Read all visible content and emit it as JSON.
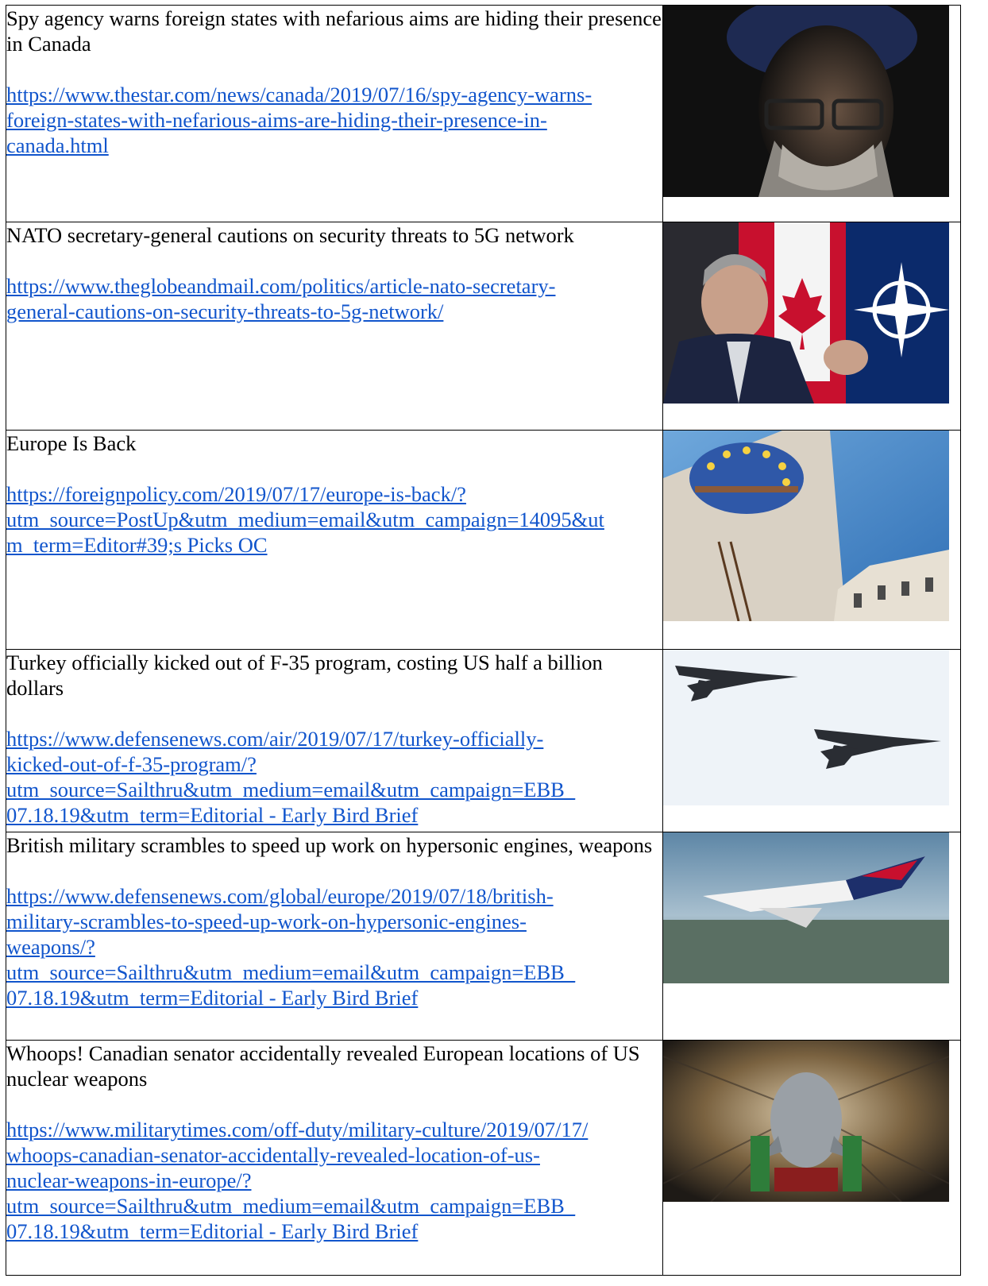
{
  "articles": [
    {
      "headline": "Spy agency warns foreign states with nefarious aims are hiding their presence in Canada",
      "link_lines": [
        "https://www.thestar.com/news/canada/2019/07/16/spy-agency-warns-",
        "foreign-states-with-nefarious-aims-are-hiding-their-presence-in-",
        "canada.html"
      ],
      "image": "portrait-photo-sajjan"
    },
    {
      "headline": "NATO secretary-general cautions on security threats to 5G network",
      "link_lines": [
        "https://www.theglobeandmail.com/politics/article-nato-secretary-",
        "general-cautions-on-security-threats-to-5g-network/"
      ],
      "image": "nato-flags-photo"
    },
    {
      "headline": "Europe Is Back",
      "link_lines": [
        "https://foreignpolicy.com/2019/07/17/europe-is-back/?",
        "utm_source=PostUp&utm_medium=email&utm_campaign=14095&ut",
        "m_term=Editor#39;s Picks OC"
      ],
      "image": "eu-mural-photo"
    },
    {
      "headline": "Turkey officially kicked out of F-35 program, costing US half a billion dollars",
      "link_lines": [
        "https://www.defensenews.com/air/2019/07/17/turkey-officially-",
        "kicked-out-of-f-35-program/?",
        "utm_source=Sailthru&utm_medium=email&utm_campaign=EBB_",
        "07.18.19&utm_term=Editorial - Early Bird Brief"
      ],
      "image": "f35-jets-photo"
    },
    {
      "headline": "British military scrambles to speed up work on hypersonic engines, weapons",
      "link_lines": [
        "https://www.defensenews.com/global/europe/2019/07/18/british-",
        "military-scrambles-to-speed-up-work-on-hypersonic-engines-",
        "weapons/?",
        "utm_source=Sailthru&utm_medium=email&utm_campaign=EBB_",
        "07.18.19&utm_term=Editorial - Early Bird Brief"
      ],
      "image": "hypersonic-plane-photo"
    },
    {
      "headline": "Whoops! Canadian senator accidentally revealed European locations of US nuclear weapons",
      "link_lines": [
        "https://www.militarytimes.com/off-duty/military-culture/2019/07/17/",
        "whoops-canadian-senator-accidentally-revealed-location-of-us-",
        "nuclear-weapons-in-europe/?",
        "utm_source=Sailthru&utm_medium=email&utm_campaign=EBB_",
        "07.18.19&utm_term=Editorial - Early Bird Brief"
      ],
      "image": "nuclear-bomb-photo"
    }
  ]
}
